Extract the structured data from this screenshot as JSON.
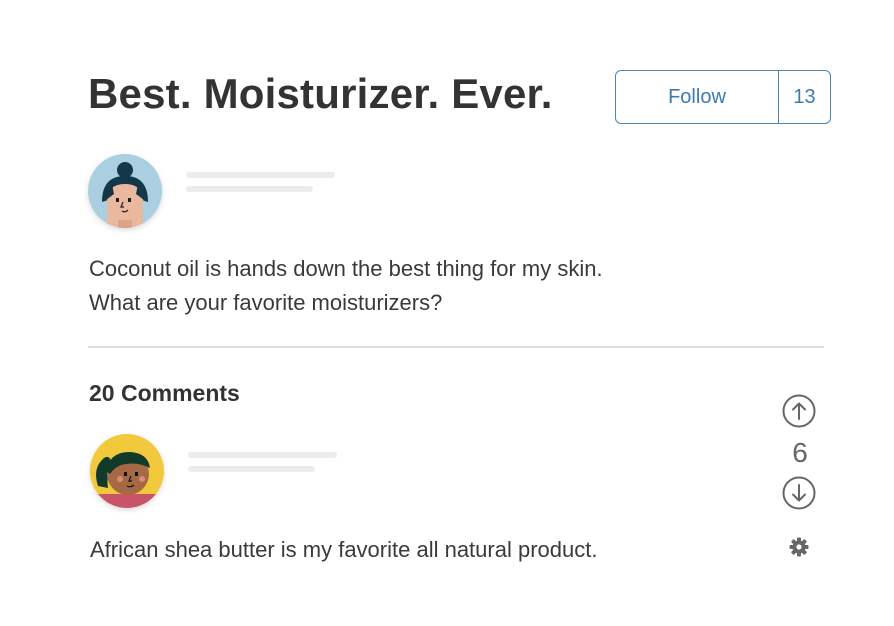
{
  "post": {
    "title": "Best. Moisturizer. Ever.",
    "follow_label": "Follow",
    "follower_count": "13",
    "body_line1": "Coconut oil is hands down the best thing for my skin.",
    "body_line2": "What are your favorite moisturizers?"
  },
  "comments": {
    "heading": "20 Comments",
    "items": [
      {
        "text": "African shea butter is my favorite all natural product.",
        "votes": "6"
      }
    ]
  },
  "icons": {
    "upvote": "arrow-up-circle-icon",
    "downvote": "arrow-down-circle-icon",
    "settings": "gear-icon"
  },
  "colors": {
    "accent": "#3c7bb0",
    "text": "#333333",
    "divider": "#dedede",
    "placeholder": "#ececec"
  }
}
